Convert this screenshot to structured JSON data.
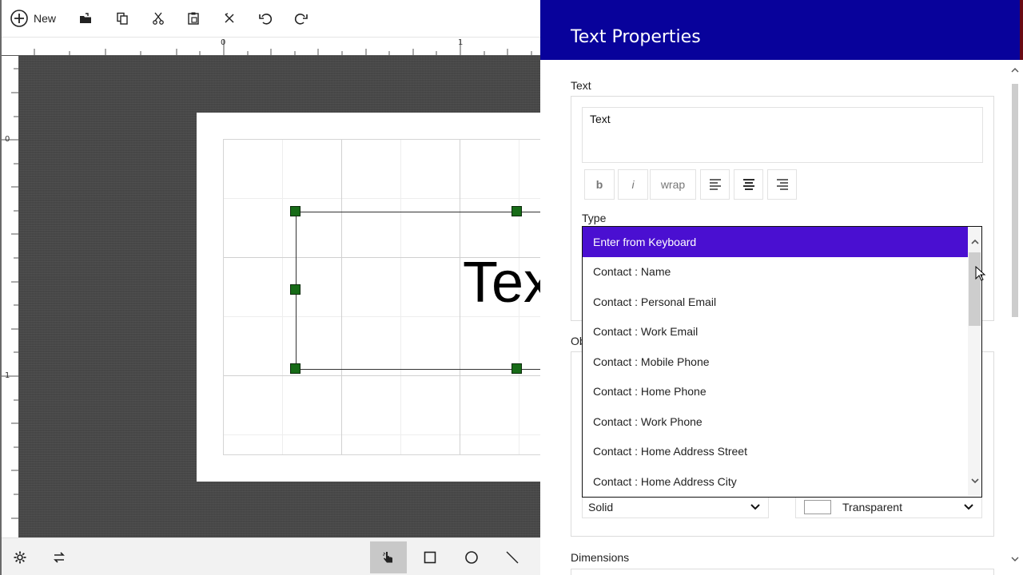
{
  "toolbar": {
    "new_label": "New",
    "icons": [
      "new-icon",
      "open-icon",
      "copy-icon",
      "cut-icon",
      "paste-icon",
      "delete-icon",
      "undo-icon",
      "redo-icon"
    ]
  },
  "rulers": {
    "top_labels": [
      "0",
      "1"
    ],
    "left_labels": [
      "0",
      "1"
    ]
  },
  "canvas": {
    "object_text": "Text"
  },
  "bottombar": {
    "icons": [
      "settings-icon",
      "swap-icon",
      "pointer-icon",
      "rectangle-icon",
      "ellipse-icon",
      "line-icon"
    ],
    "active_tool": "pointer"
  },
  "panel": {
    "title": "Text Properties",
    "text_section_label": "Text",
    "text_value": "Text",
    "format_buttons": {
      "bold": "b",
      "italic": "i",
      "wrap": "wrap"
    },
    "type_label": "Type",
    "type_options": [
      "Enter from Keyboard",
      "Contact : Name",
      "Contact : Personal Email",
      "Contact : Work Email",
      "Contact : Mobile Phone",
      "Contact : Home Phone",
      "Contact : Work Phone",
      "Contact : Home Address Street",
      "Contact : Home Address City"
    ],
    "type_selected": "Enter from Keyboard",
    "object_section_label_partial": "Ob",
    "line_style": "Solid",
    "fill_color": "Transparent",
    "dimensions_label": "Dimensions"
  },
  "colors": {
    "header_bg": "#08029b",
    "selected_option_bg": "#4a0fd1",
    "handle_color": "#176b17"
  }
}
